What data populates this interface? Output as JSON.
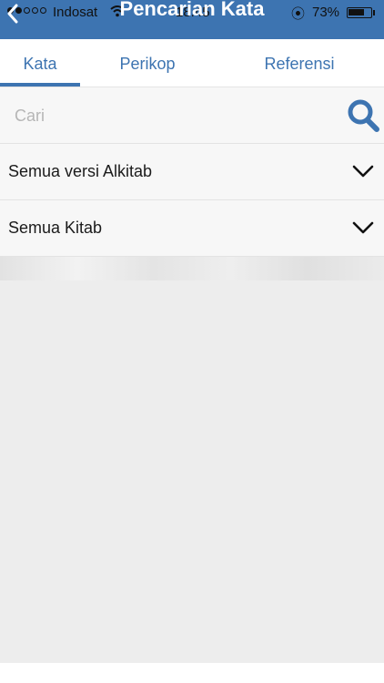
{
  "status_bar": {
    "carrier": "Indosat",
    "time": "18.45",
    "battery_percent": "73%",
    "battery_level": 0.73,
    "signal_bars_filled": 2,
    "signal_bars_total": 5
  },
  "header": {
    "title": "Pencarian Kata",
    "back_icon": "chevron-left-icon"
  },
  "tabs": [
    {
      "label": "Kata",
      "active": true
    },
    {
      "label": "Perikop",
      "active": false
    },
    {
      "label": "Referensi",
      "active": false
    }
  ],
  "search": {
    "placeholder": "Cari",
    "value": "",
    "icon": "search-icon"
  },
  "filters": {
    "version": {
      "label": "Semua versi Alkitab",
      "icon": "chevron-down-icon"
    },
    "book": {
      "label": "Semua Kitab",
      "icon": "chevron-down-icon"
    }
  },
  "colors": {
    "accent": "#3d74b1",
    "background": "#ededed",
    "row_background": "#f7f7f7"
  }
}
